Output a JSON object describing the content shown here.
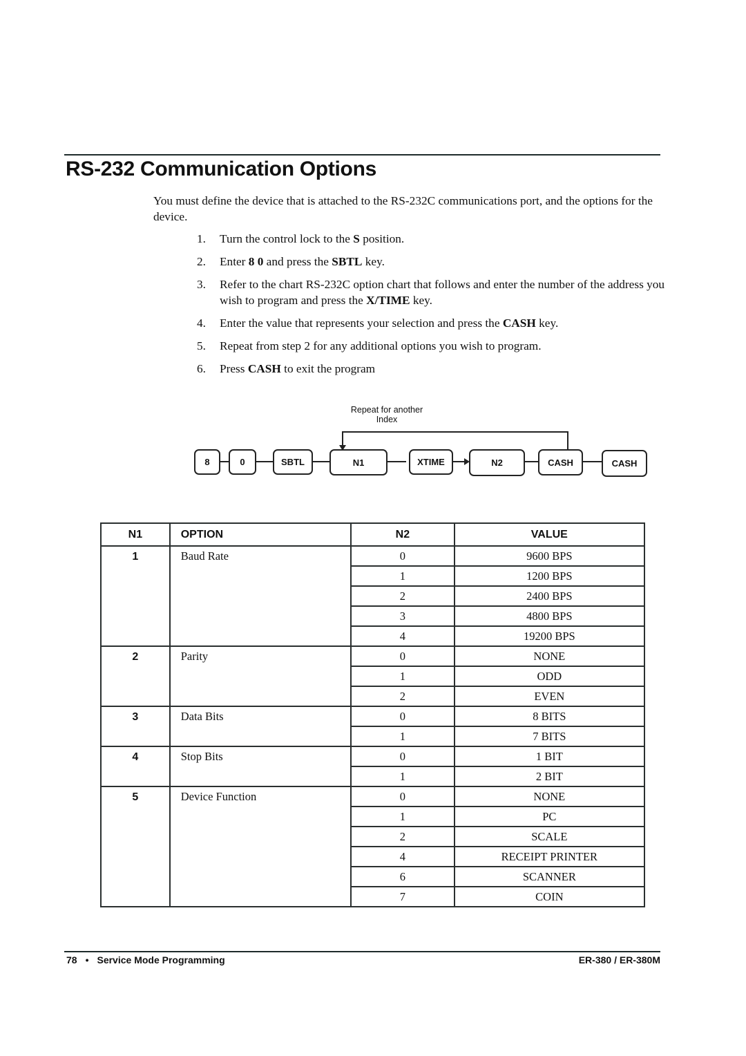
{
  "page": {
    "title": "RS-232 Communication Options",
    "intro": "You must define the device that is attached to the RS-232C communications port, and the options for the device.",
    "steps": [
      {
        "num": "1.",
        "parts": [
          {
            "t": "Turn the control lock to the "
          },
          {
            "t": "S",
            "b": true
          },
          {
            "t": " position."
          }
        ]
      },
      {
        "num": "2.",
        "parts": [
          {
            "t": "Enter "
          },
          {
            "t": "8 0",
            "b": true
          },
          {
            "t": " and press the "
          },
          {
            "t": "SBTL",
            "b": true
          },
          {
            "t": " key."
          }
        ]
      },
      {
        "num": "3.",
        "parts": [
          {
            "t": "Refer to the chart RS-232C option chart that follows and enter the number of the address you wish to program and press the "
          },
          {
            "t": "X/TIME",
            "b": true
          },
          {
            "t": " key."
          }
        ]
      },
      {
        "num": "4.",
        "parts": [
          {
            "t": "Enter the value that represents your selection and press the "
          },
          {
            "t": "CASH",
            "b": true
          },
          {
            "t": " key."
          }
        ]
      },
      {
        "num": "5.",
        "parts": [
          {
            "t": "Repeat from step 2 for any additional options you wish to program."
          }
        ]
      },
      {
        "num": "6.",
        "parts": [
          {
            "t": "Press "
          },
          {
            "t": "CASH",
            "b": true
          },
          {
            "t": " to exit the program"
          }
        ]
      }
    ]
  },
  "diagram": {
    "loop_label_line1": "Repeat for another",
    "loop_label_line2": "Index",
    "keys": [
      "8",
      "0",
      "SBTL",
      "N1",
      "XTIME",
      "N2",
      "CASH",
      "CASH"
    ]
  },
  "table": {
    "headers": {
      "n1": "N1",
      "option": "OPTION",
      "n2": "N2",
      "value": "VALUE"
    },
    "groups": [
      {
        "n1": "1",
        "option": "Baud Rate",
        "rows": [
          {
            "n2": "0",
            "value": "9600 BPS"
          },
          {
            "n2": "1",
            "value": "1200 BPS"
          },
          {
            "n2": "2",
            "value": "2400 BPS"
          },
          {
            "n2": "3",
            "value": "4800 BPS"
          },
          {
            "n2": "4",
            "value": "19200 BPS"
          }
        ]
      },
      {
        "n1": "2",
        "option": "Parity",
        "rows": [
          {
            "n2": "0",
            "value": "NONE"
          },
          {
            "n2": "1",
            "value": "ODD"
          },
          {
            "n2": "2",
            "value": "EVEN"
          }
        ]
      },
      {
        "n1": "3",
        "option": "Data Bits",
        "rows": [
          {
            "n2": "0",
            "value": "8 BITS"
          },
          {
            "n2": "1",
            "value": "7 BITS"
          }
        ]
      },
      {
        "n1": "4",
        "option": "Stop Bits",
        "rows": [
          {
            "n2": "0",
            "value": "1 BIT"
          },
          {
            "n2": "1",
            "value": "2 BIT"
          }
        ]
      },
      {
        "n1": "5",
        "option": "Device Function",
        "rows": [
          {
            "n2": "0",
            "value": "NONE"
          },
          {
            "n2": "1",
            "value": "PC"
          },
          {
            "n2": "2",
            "value": "SCALE"
          },
          {
            "n2": "4",
            "value": "RECEIPT PRINTER"
          },
          {
            "n2": "6",
            "value": "SCANNER"
          },
          {
            "n2": "7",
            "value": "COIN"
          }
        ]
      }
    ]
  },
  "footer": {
    "page_number": "78",
    "bullet": "•",
    "section": "Service Mode Programming",
    "model": "ER-380 / ER-380M"
  }
}
